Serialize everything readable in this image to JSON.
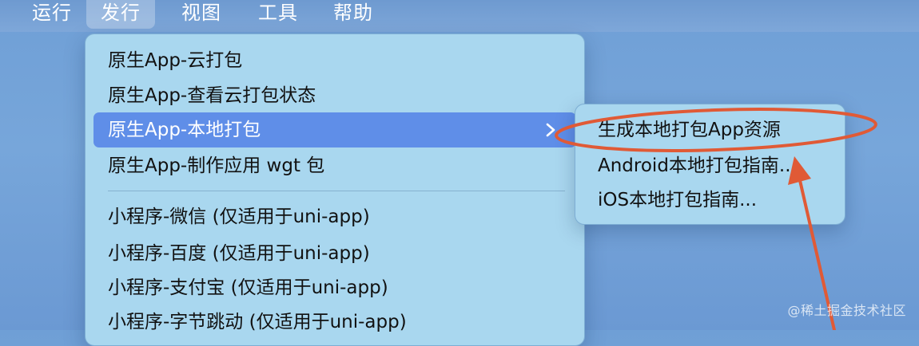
{
  "menubar": {
    "items": [
      "运行",
      "发行",
      "视图",
      "工具",
      "帮助"
    ]
  },
  "dropdown": {
    "items": [
      {
        "label": "原生App-云打包"
      },
      {
        "label": "原生App-查看云打包状态"
      },
      {
        "label": "原生App-本地打包"
      },
      {
        "label": "原生App-制作应用 wgt 包"
      },
      {
        "label": "小程序-微信 (仅适用于uni-app)"
      },
      {
        "label": "小程序-百度 (仅适用于uni-app)"
      },
      {
        "label": "小程序-支付宝 (仅适用于uni-app)"
      },
      {
        "label": "小程序-字节跳动 (仅适用于uni-app)"
      }
    ]
  },
  "submenu": {
    "items": [
      {
        "label": "生成本地打包App资源"
      },
      {
        "label": "Android本地打包指南..."
      },
      {
        "label": "iOS本地打包指南..."
      }
    ]
  },
  "watermark": "@稀土掘金技术社区",
  "colors": {
    "desktop": "#77a6da",
    "menu_background": "#a9d7ef",
    "highlight": "#5f8ee8",
    "annotation": "#e05a36"
  },
  "icons": {
    "submenu_indicator": "chevron-right-icon"
  }
}
